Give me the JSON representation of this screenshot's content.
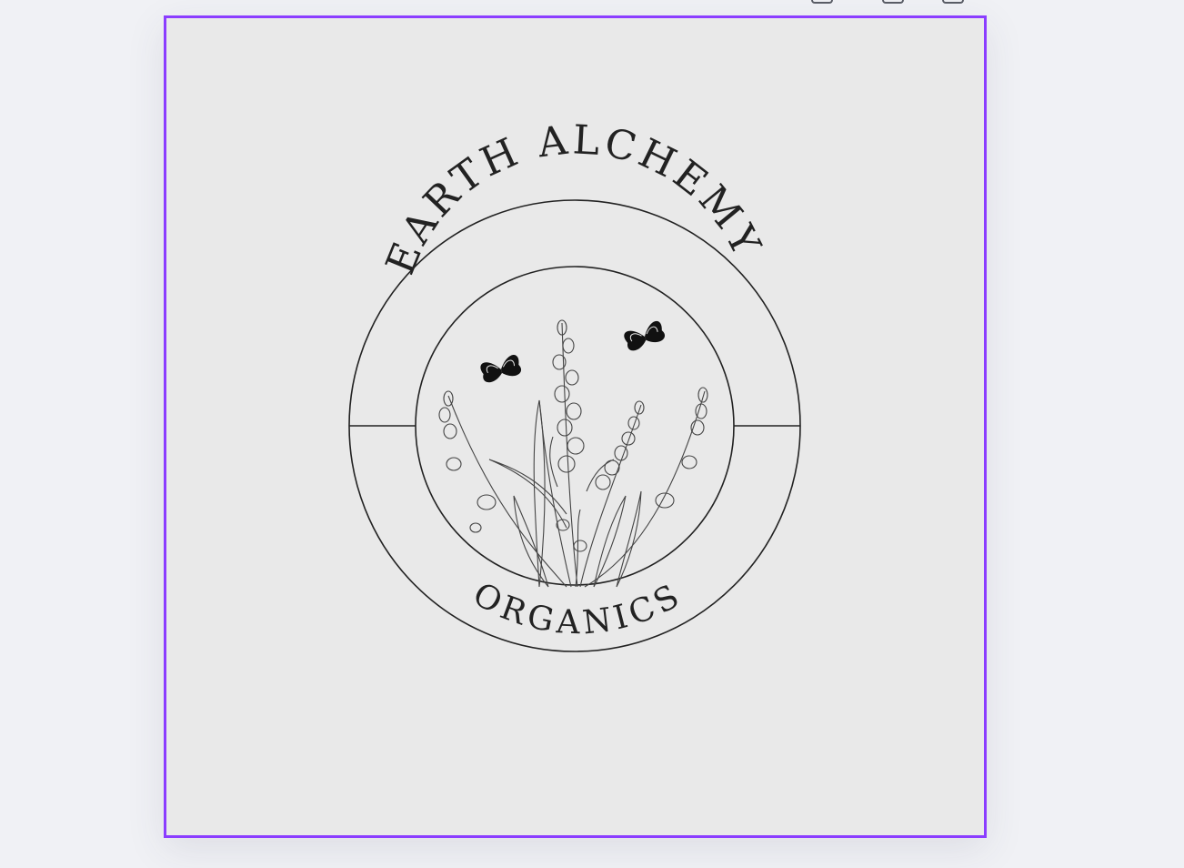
{
  "toolbar": {
    "icons": [
      "lock-icon",
      "copy-icon",
      "add-page-icon"
    ]
  },
  "logo": {
    "top_text": "EARTH ALCHEMY",
    "bottom_text": "ORGANICS",
    "stroke_color": "#222222",
    "background_color": "#e9e9e9"
  },
  "selection": {
    "color": "#8b3dff"
  }
}
